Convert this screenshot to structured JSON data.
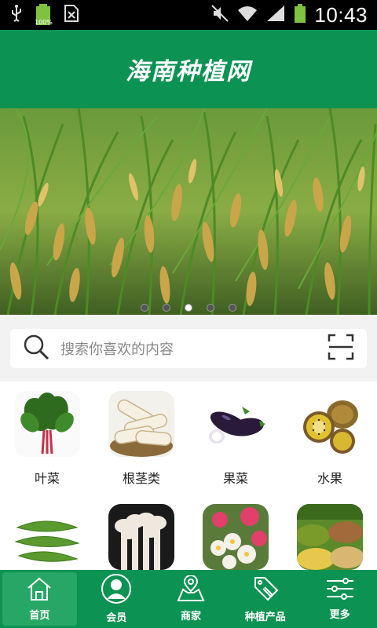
{
  "status_bar": {
    "time": "10:43",
    "battery_percent": "100%",
    "icons": [
      "usb-icon",
      "battery-icon",
      "sim-icon",
      "mute-icon",
      "wifi-icon",
      "signal-icon",
      "battery-icon"
    ]
  },
  "header": {
    "title": "海南种植网"
  },
  "banner": {
    "dots": 5,
    "active_dot": 2
  },
  "search": {
    "placeholder": "搜索你喜欢的内容",
    "search_icon": "search-icon",
    "scan_icon": "scan-icon"
  },
  "categories": [
    {
      "label": "叶菜",
      "icon": "leafy-vegetable-image"
    },
    {
      "label": "根茎类",
      "icon": "root-vegetable-image"
    },
    {
      "label": "果菜",
      "icon": "eggplant-image"
    },
    {
      "label": "水果",
      "icon": "kiwi-image"
    },
    {
      "label": "",
      "icon": "bean-image"
    },
    {
      "label": "",
      "icon": "mushroom-image"
    },
    {
      "label": "",
      "icon": "flower-image"
    },
    {
      "label": "",
      "icon": "grain-image"
    }
  ],
  "tabbar": {
    "items": [
      {
        "label": "首页",
        "icon": "home-icon",
        "active": true
      },
      {
        "label": "会员",
        "icon": "member-icon",
        "active": false
      },
      {
        "label": "商家",
        "icon": "map-location-icon",
        "active": false
      },
      {
        "label": "种植产品",
        "icon": "sale-tag-icon",
        "active": false
      },
      {
        "label": "更多",
        "icon": "settings-sliders-icon",
        "active": false
      }
    ]
  },
  "colors": {
    "brand_green": "#0c9253",
    "active_tab": "#27a766"
  }
}
